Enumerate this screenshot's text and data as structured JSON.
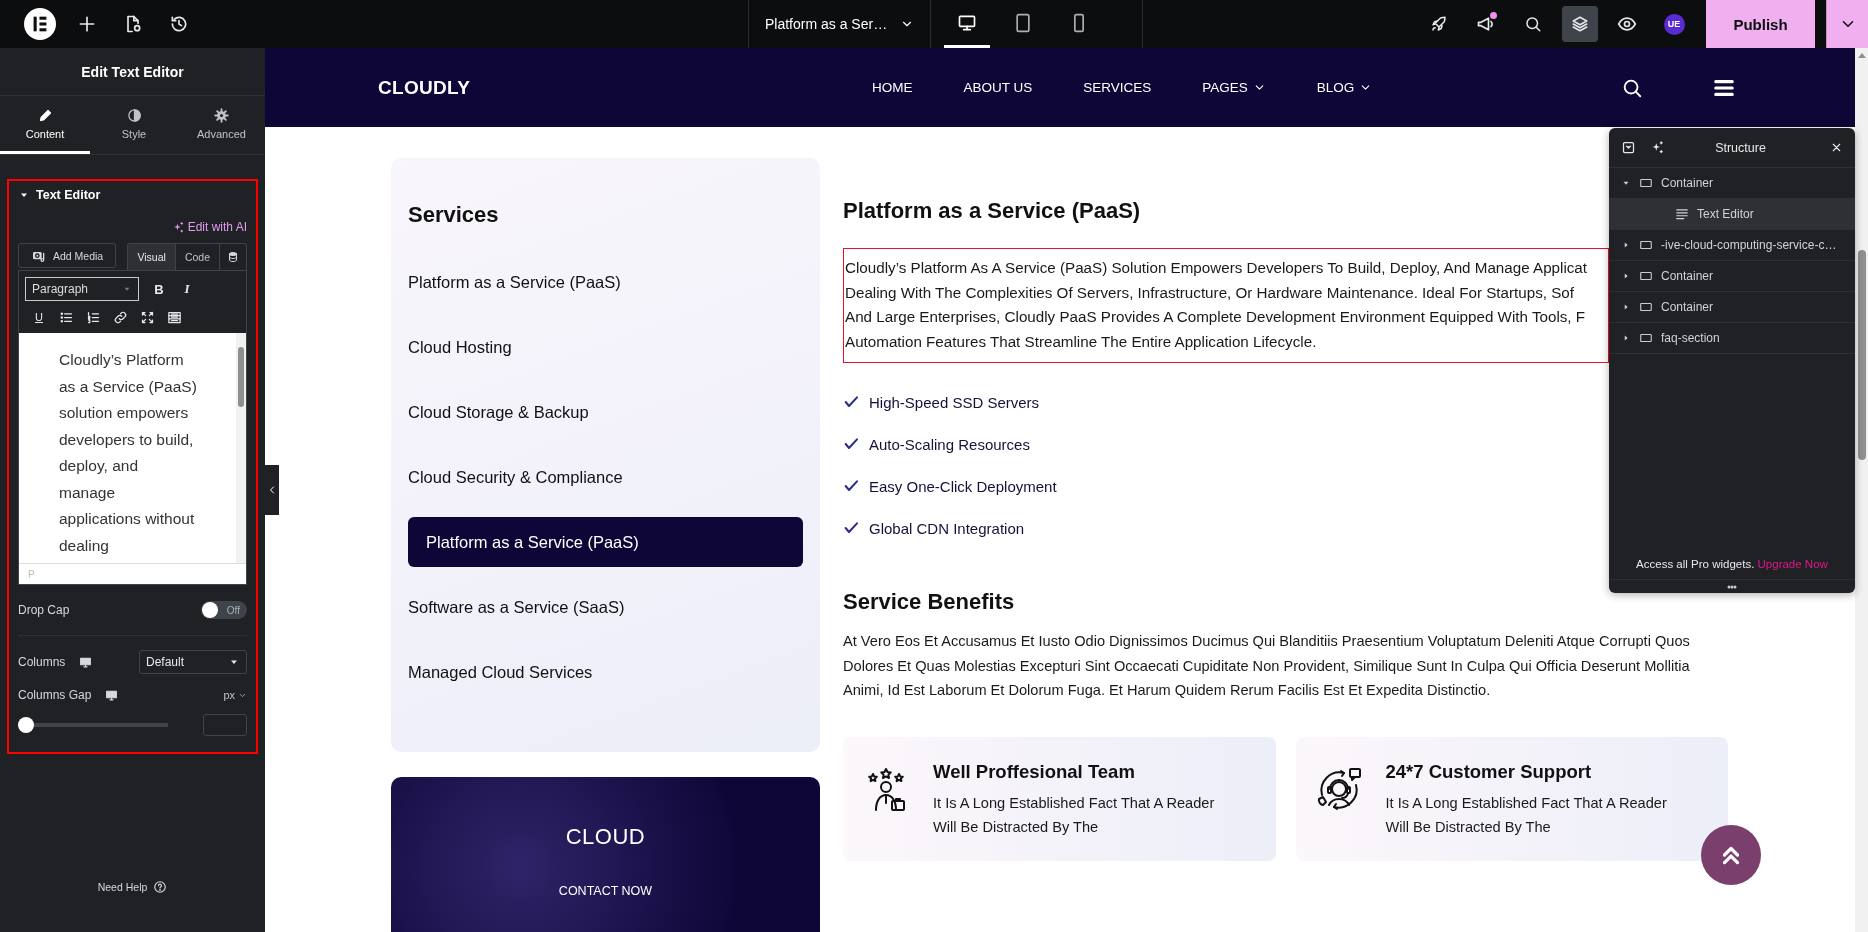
{
  "topbar": {
    "document_title": "Platform as a Ser…",
    "devices": [
      {
        "kind": "desktop",
        "selected": true
      },
      {
        "kind": "tablet",
        "selected": false
      },
      {
        "kind": "mobile",
        "selected": false
      }
    ],
    "notification": true,
    "structure_toggle": {
      "selected": true
    },
    "user_initials": "UE",
    "publish": "Publish"
  },
  "panel": {
    "title": "Edit Text Editor",
    "tabs": [
      {
        "kind": "content",
        "label": "Content",
        "selected": true
      },
      {
        "kind": "style",
        "label": "Style",
        "selected": false
      },
      {
        "kind": "advanced",
        "label": "Advanced",
        "selected": false
      }
    ],
    "section": {
      "title": "Text Editor",
      "expanded": true,
      "ai_link": "Edit with AI",
      "add_media": "Add Media",
      "modes": [
        {
          "label": "Visual",
          "selected": true
        },
        {
          "label": "Code",
          "selected": false
        }
      ],
      "format": "Paragraph",
      "format_buttons": [
        {
          "kind": "bold",
          "label": "B"
        },
        {
          "kind": "italic",
          "label": "I"
        },
        {
          "kind": "underline",
          "label": "U"
        }
      ],
      "editor_text": "Cloudly’s Platform as a Service (PaaS) solution empowers developers to build, deploy, and manage applications without dealing",
      "path": "P",
      "drop_cap": {
        "label": "Drop Cap",
        "on": false,
        "state_label": "Off"
      },
      "columns": {
        "label": "Columns",
        "value": "Default"
      },
      "columns_gap": {
        "label": "Columns Gap",
        "unit": "px",
        "level": 0
      }
    },
    "help": "Need Help"
  },
  "site": {
    "logo": "CLOUDLY",
    "nav": [
      {
        "label": "HOME",
        "dropdown": false
      },
      {
        "label": "ABOUT US",
        "dropdown": false
      },
      {
        "label": "SERVICES",
        "dropdown": false
      },
      {
        "label": "PAGES",
        "dropdown": true
      },
      {
        "label": "BLOG",
        "dropdown": true
      }
    ],
    "services": {
      "title": "Services",
      "items": [
        {
          "label": "Platform as a Service (PaaS)",
          "selected": false
        },
        {
          "label": "Cloud Hosting",
          "selected": false
        },
        {
          "label": "Cloud Storage & Backup",
          "selected": false
        },
        {
          "label": "Cloud Security & Compliance",
          "selected": false
        },
        {
          "label": "Platform as a Service (PaaS)",
          "selected": true
        },
        {
          "label": "Software as a Service (SaaS)",
          "selected": false
        },
        {
          "label": "Managed Cloud Services",
          "selected": false
        }
      ]
    },
    "contact_card": {
      "title": "CLOUD",
      "subtitle": "CONTACT NOW"
    },
    "article": {
      "title": "Platform as a Service (PaaS)",
      "intro_lines": [
        "Cloudly’s Platform As A Service (PaaS) Solution Empowers Developers To Build, Deploy, And Manage Applicat",
        "Dealing With The Complexities Of Servers, Infrastructure, Or Hardware Maintenance. Ideal For Startups, Sof",
        "And Large Enterprises, Cloudly PaaS Provides A Complete Development Environment Equipped With Tools, F",
        "Automation Features That Streamline The Entire Application Lifecycle."
      ],
      "features": [
        "High-Speed SSD Servers",
        "Auto-Scaling Resources",
        "Easy One-Click Deployment",
        "Global CDN Integration"
      ],
      "benefits_title": "Service Benefits",
      "benefits_text": "At Vero Eos Et Accusamus Et Iusto Odio Dignissimos Ducimus Qui Blanditiis Praesentium Voluptatum Deleniti Atque Corrupti Quos Dolores Et Quas Molestias Excepturi Sint Occaecati Cupiditate Non Provident, Similique Sunt In Culpa Qui Officia Deserunt Mollitia Animi, Id Est Laborum Et Dolorum Fuga. Et Harum Quidem Rerum Facilis Est Et Expedita Distinctio.",
      "cards": [
        {
          "kind": "team",
          "title": "Well Proffesional Team",
          "text": "It Is A Long Established Fact That A Reader Will Be Distracted By The"
        },
        {
          "kind": "support",
          "title": "24*7 Customer Support",
          "text": "It Is A Long Established Fact That A Reader Will Be Distracted By The"
        }
      ]
    }
  },
  "structure": {
    "title": "Structure",
    "items": [
      {
        "kind": "container",
        "label": "Container",
        "expanded": true,
        "selected": false,
        "children": [
          {
            "kind": "text",
            "label": "Text Editor",
            "selected": true
          }
        ]
      },
      {
        "kind": "container",
        "label": "-ive-cloud-computing-service-c…",
        "expanded": false,
        "selected": false
      },
      {
        "kind": "container",
        "label": "Container",
        "expanded": false,
        "selected": false
      },
      {
        "kind": "container",
        "label": "Container",
        "expanded": false,
        "selected": false
      },
      {
        "kind": "container",
        "label": "faq-section",
        "expanded": false,
        "selected": false
      }
    ],
    "footer": "Access all Pro widgets.",
    "upgrade": "Upgrade Now"
  }
}
